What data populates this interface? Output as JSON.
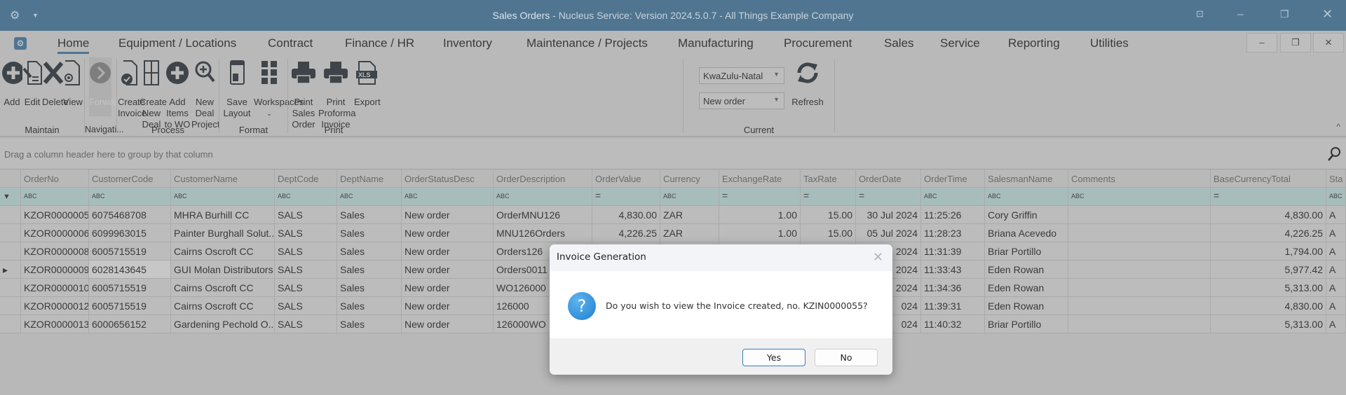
{
  "window": {
    "title_app": "Sales Orders",
    "title_rest": " - Nucleus Service: Version 2024.5.0.7 - All Things Example Company"
  },
  "tabs": [
    "Home",
    "Equipment / Locations",
    "Contract",
    "Finance / HR",
    "Inventory",
    "Maintenance / Projects",
    "Manufacturing",
    "Procurement",
    "Sales",
    "Service",
    "Reporting",
    "Utilities"
  ],
  "ribbon": {
    "buttons": {
      "add": "Add",
      "edit": "Edit",
      "delete": "Delete",
      "view": "View",
      "forward": "Forward",
      "create_invoice": "Create Invoice",
      "create_new_deal": "Create New Deal",
      "add_items_wo": "Add Items to WO",
      "new_deal_project": "New Deal Project",
      "save_layout": "Save Layout",
      "workspaces": "Workspaces",
      "print_sales_order": "Print Sales Order",
      "print_proforma": "Print Proforma Invoice",
      "export": "Export",
      "refresh": "Refresh"
    },
    "groups": {
      "maintain": "Maintain",
      "navigation": "Navigati...",
      "process": "Process",
      "format": "Format",
      "print": "Print",
      "current": "Current"
    },
    "region_combo": "KwaZulu-Natal",
    "status_combo": "New order"
  },
  "grid": {
    "group_hint": "Drag a column header here to group by that column",
    "columns": [
      "OrderNo",
      "CustomerCode",
      "CustomerName",
      "DeptCode",
      "DeptName",
      "OrderStatusDesc",
      "OrderDescription",
      "OrderValue",
      "Currency",
      "ExchangeRate",
      "TaxRate",
      "OrderDate",
      "OrderTime",
      "SalesmanName",
      "Comments",
      "BaseCurrencyTotal",
      "Sta"
    ],
    "filters": [
      "ABC",
      "ABC",
      "ABC",
      "ABC",
      "ABC",
      "ABC",
      "ABC",
      "=",
      "ABC",
      "=",
      "=",
      "=",
      "ABC",
      "ABC",
      "ABC",
      "=",
      "ABC"
    ],
    "rows": [
      [
        "KZOR0000005",
        "6075468708",
        "MHRA Burhill CC",
        "SALS",
        "Sales",
        "New order",
        "OrderMNU126",
        "4,830.00",
        "ZAR",
        "1.00",
        "15.00",
        "30 Jul 2024",
        "11:25:26",
        "Cory Griffin",
        "",
        "4,830.00",
        "A"
      ],
      [
        "KZOR0000006",
        "6099963015",
        "Painter Burghall Solut...",
        "SALS",
        "Sales",
        "New order",
        "MNU126Orders",
        "4,226.25",
        "ZAR",
        "1.00",
        "15.00",
        "05 Jul 2024",
        "11:28:23",
        "Briana Acevedo",
        "",
        "4,226.25",
        "A"
      ],
      [
        "KZOR0000008",
        "6005715519",
        "Cairns Oscroft CC",
        "SALS",
        "Sales",
        "New order",
        "Orders126",
        "",
        "",
        "",
        "",
        "2024",
        "11:31:39",
        "Briar Portillo",
        "",
        "1,794.00",
        "A"
      ],
      [
        "KZOR0000009",
        "6028143645",
        "GUI Molan Distributors",
        "SALS",
        "Sales",
        "New order",
        "Orders0011",
        "",
        "",
        "",
        "",
        "2024",
        "11:33:43",
        "Eden Rowan",
        "",
        "5,977.42",
        "A"
      ],
      [
        "KZOR0000010",
        "6005715519",
        "Cairns Oscroft CC",
        "SALS",
        "Sales",
        "New order",
        "WO126000",
        "",
        "",
        "",
        "",
        "2024",
        "11:34:36",
        "Eden Rowan",
        "",
        "5,313.00",
        "A"
      ],
      [
        "KZOR0000012",
        "6005715519",
        "Cairns Oscroft CC",
        "SALS",
        "Sales",
        "New order",
        "126000",
        "",
        "",
        "",
        "",
        "024",
        "11:39:31",
        "Eden Rowan",
        "",
        "4,830.00",
        "A"
      ],
      [
        "KZOR0000013",
        "6000656152",
        "Gardening Pechold O...",
        "SALS",
        "Sales",
        "New order",
        "126000WO",
        "",
        "",
        "",
        "",
        "024",
        "11:40:32",
        "Briar Portillo",
        "",
        "5,313.00",
        "A"
      ]
    ],
    "selected_row": 3
  },
  "dialog": {
    "title": "Invoice Generation",
    "message": "Do you wish to view the Invoice created, no. KZIN0000055?",
    "yes": "Yes",
    "no": "No"
  }
}
